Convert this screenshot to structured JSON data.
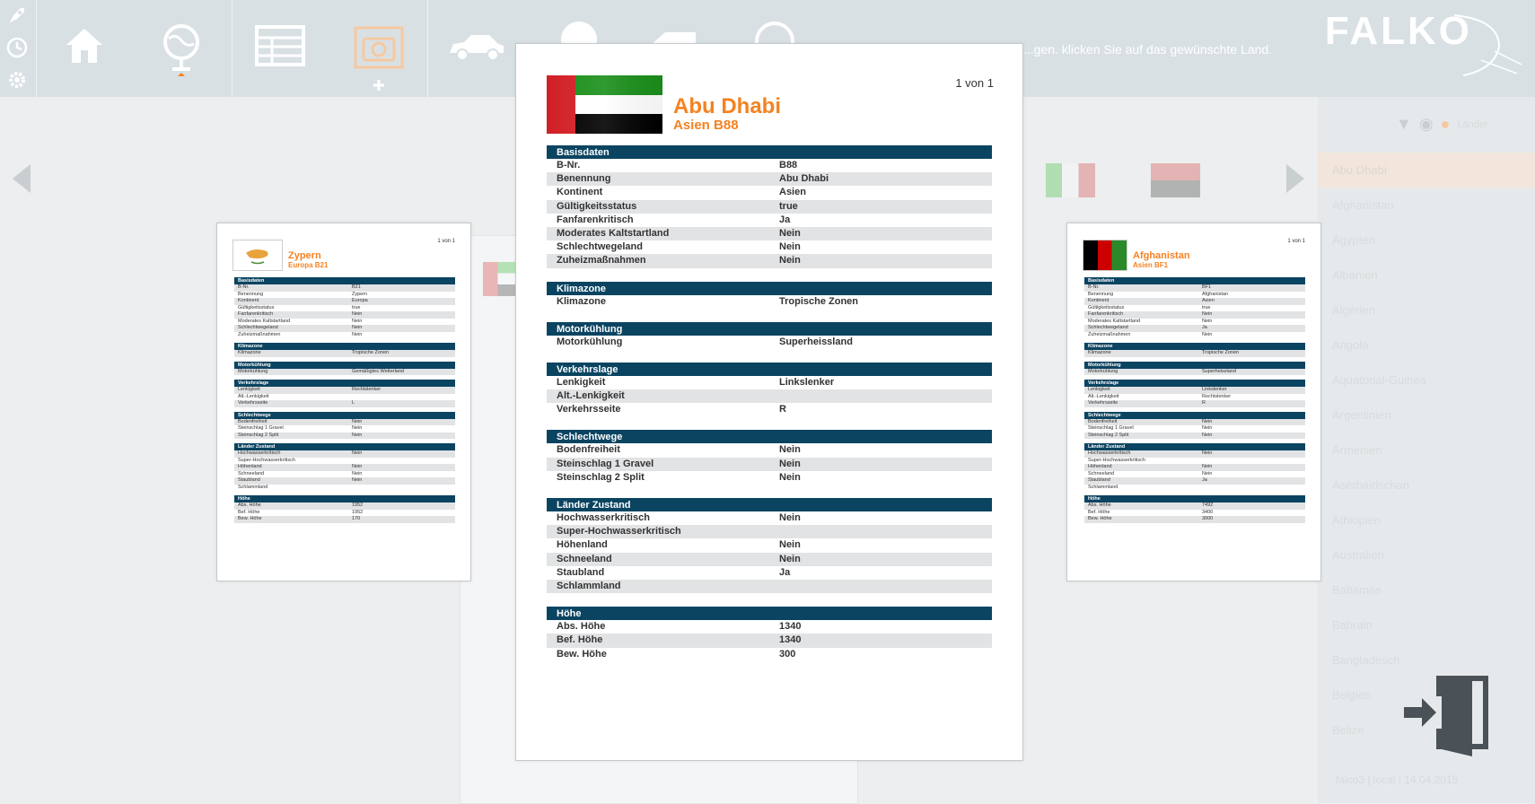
{
  "app": {
    "logo": "FALKO",
    "hint": "...gen. klicken Sie auf das gewünschte Land."
  },
  "toolbar": {
    "icons": [
      "rocket-icon",
      "clock-icon",
      "gear-icon",
      "home-icon",
      "globe-icon",
      "table-icon",
      "camera-icon",
      "car-icon",
      "world-icon",
      "tag-icon",
      "info-icon"
    ]
  },
  "main_doc": {
    "name": "Abu Dhabi",
    "sub": "Asien B88",
    "page": "1 von 1",
    "sections": [
      {
        "title": "Basisdaten",
        "rows": [
          [
            "B-Nr.",
            "B88"
          ],
          [
            "Benennung",
            "Abu Dhabi"
          ],
          [
            "Kontinent",
            "Asien"
          ],
          [
            "Gültigkeitsstatus",
            "true"
          ],
          [
            "Fanfarenkritisch",
            "Ja"
          ],
          [
            "Moderates Kaltstartland",
            "Nein"
          ],
          [
            "Schlechtwegeland",
            "Nein"
          ],
          [
            "Zuheizmaßnahmen",
            "Nein"
          ]
        ]
      },
      {
        "title": "Klimazone",
        "rows": [
          [
            "Klimazone",
            "Tropische Zonen"
          ]
        ]
      },
      {
        "title": "Motorkühlung",
        "rows": [
          [
            "Motorkühlung",
            "Superheissland"
          ]
        ]
      },
      {
        "title": "Verkehrslage",
        "rows": [
          [
            "Lenkigkeit",
            "Linkslenker"
          ],
          [
            "Alt.-Lenkigkeit",
            ""
          ],
          [
            "Verkehrsseite",
            "R"
          ]
        ]
      },
      {
        "title": "Schlechtwege",
        "rows": [
          [
            "Bodenfreiheit",
            "Nein"
          ],
          [
            "Steinschlag 1 Gravel",
            "Nein"
          ],
          [
            "Steinschlag 2 Split",
            "Nein"
          ]
        ]
      },
      {
        "title": "Länder Zustand",
        "rows": [
          [
            "Hochwasserkritisch",
            "Nein"
          ],
          [
            "Super-Hochwasserkritisch",
            ""
          ],
          [
            "Höhenland",
            "Nein"
          ],
          [
            "Schneeland",
            "Nein"
          ],
          [
            "Staubland",
            "Ja"
          ],
          [
            "Schlammland",
            ""
          ]
        ]
      },
      {
        "title": "Höhe",
        "rows": [
          [
            "Abs. Höhe",
            "1340"
          ],
          [
            "Bef. Höhe",
            "1340"
          ],
          [
            "Bew. Höhe",
            "300"
          ]
        ]
      }
    ]
  },
  "left_doc": {
    "name": "Zypern",
    "sub": "Europa B21",
    "page": "1 von 1",
    "sections": [
      {
        "title": "Basisdaten",
        "rows": [
          [
            "B-Nr.",
            "B21"
          ],
          [
            "Benennung",
            "Zypern"
          ],
          [
            "Kontinent",
            "Europa"
          ],
          [
            "Gültigkeitsstatus",
            "true"
          ],
          [
            "Fanfarenkritisch",
            "Nein"
          ],
          [
            "Moderates Kaltstartland",
            "Nein"
          ],
          [
            "Schlechtwegeland",
            "Nein"
          ],
          [
            "Zuheizmaßnahmen",
            "Nein"
          ]
        ]
      },
      {
        "title": "Klimazone",
        "rows": [
          [
            "Klimazone",
            "Tropische Zonen"
          ]
        ]
      },
      {
        "title": "Motorkühlung",
        "rows": [
          [
            "Motorkühlung",
            "Gemäßigtes Wetterland"
          ]
        ]
      },
      {
        "title": "Verkehrslage",
        "rows": [
          [
            "Lenkigkeit",
            "Rechtslenker"
          ],
          [
            "Alt.-Lenkigkeit",
            ""
          ],
          [
            "Verkehrsseite",
            "L"
          ]
        ]
      },
      {
        "title": "Schlechtwege",
        "rows": [
          [
            "Bodenfreiheit",
            "Nein"
          ],
          [
            "Steinschlag 1 Gravel",
            "Nein"
          ],
          [
            "Steinschlag 2 Split",
            "Nein"
          ]
        ]
      },
      {
        "title": "Länder Zustand",
        "rows": [
          [
            "Hochwasserkritisch",
            "Nein"
          ],
          [
            "Super-Hochwasserkritisch",
            ""
          ],
          [
            "Höhenland",
            "Nein"
          ],
          [
            "Schneeland",
            "Nein"
          ],
          [
            "Staubland",
            "Nein"
          ],
          [
            "Schlammland",
            ""
          ]
        ]
      },
      {
        "title": "Höhe",
        "rows": [
          [
            "Abs. Höhe",
            "1952"
          ],
          [
            "Bef. Höhe",
            "1952"
          ],
          [
            "Bew. Höhe",
            "170"
          ]
        ]
      }
    ]
  },
  "right_doc": {
    "name": "Afghanistan",
    "sub": "Asien BF1",
    "page": "1 von 1",
    "sections": [
      {
        "title": "Basisdaten",
        "rows": [
          [
            "B-Nr.",
            "BF1"
          ],
          [
            "Benennung",
            "Afghanistan"
          ],
          [
            "Kontinent",
            "Asien"
          ],
          [
            "Gültigkeitsstatus",
            "true"
          ],
          [
            "Fanfarenkritisch",
            "Nein"
          ],
          [
            "Moderates Kaltstartland",
            "Nein"
          ],
          [
            "Schlechtwegeland",
            "Ja"
          ],
          [
            "Zuheizmaßnahmen",
            "Nein"
          ]
        ]
      },
      {
        "title": "Klimazone",
        "rows": [
          [
            "Klimazone",
            "Tropische Zonen"
          ]
        ]
      },
      {
        "title": "Motorkühlung",
        "rows": [
          [
            "Motorkühlung",
            "Superheissland"
          ]
        ]
      },
      {
        "title": "Verkehrslage",
        "rows": [
          [
            "Lenkigkeit",
            "Linkslenker"
          ],
          [
            "Alt.-Lenkigkeit",
            "Rechtslenker"
          ],
          [
            "Verkehrsseite",
            "R"
          ]
        ]
      },
      {
        "title": "Schlechtwege",
        "rows": [
          [
            "Bodenfreiheit",
            "Nein"
          ],
          [
            "Steinschlag 1 Gravel",
            "Nein"
          ],
          [
            "Steinschlag 2 Split",
            "Nein"
          ]
        ]
      },
      {
        "title": "Länder Zustand",
        "rows": [
          [
            "Hochwasserkritisch",
            "Nein"
          ],
          [
            "Super-Hochwasserkritisch",
            ""
          ],
          [
            "Höhenland",
            "Nein"
          ],
          [
            "Schneeland",
            "Nein"
          ],
          [
            "Staubland",
            "Ja"
          ],
          [
            "Schlammland",
            ""
          ]
        ]
      },
      {
        "title": "Höhe",
        "rows": [
          [
            "Abs. Höhe",
            "7492"
          ],
          [
            "Bef. Höhe",
            "3400"
          ],
          [
            "Bew. Höhe",
            "3000"
          ]
        ]
      }
    ]
  },
  "sidebar": {
    "tools": [
      "filter-icon",
      "eye-icon",
      "sun-icon"
    ],
    "tool_label": "Länder",
    "items": [
      "Abu Dhabi",
      "Afghanistan",
      "Ägypten",
      "Albanien",
      "Algerien",
      "Angola",
      "Äquatorial-Guinea",
      "Argentinien",
      "Armenien",
      "Aserbaidschan",
      "Äthiopien",
      "Australien",
      "Bahamas",
      "Bahrain",
      "Bangladesch",
      "Belgien",
      "Belize"
    ],
    "active_index": 0,
    "footer": "falco3 | local | 14.04.2015"
  },
  "colors": {
    "accent": "#f58220",
    "section": "#0a4461",
    "stripe": "#e2e3e5"
  }
}
